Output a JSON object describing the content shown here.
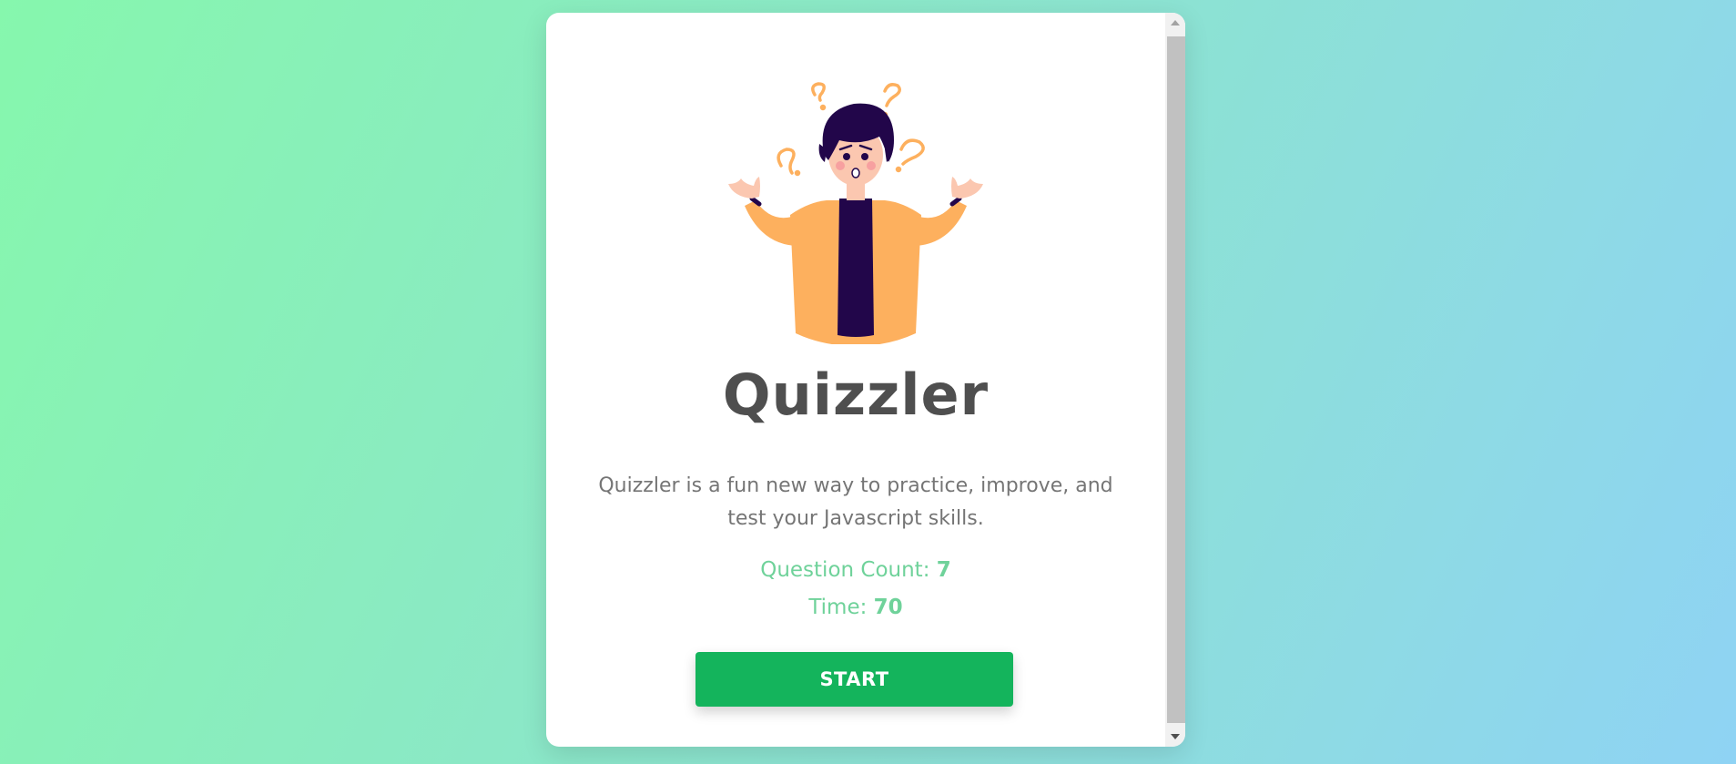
{
  "app": {
    "title": "Quizzler",
    "description": "Quizzler is a fun new way to practice, improve, and test your Javascript skills."
  },
  "stats": {
    "question_count_label": "Question Count: ",
    "question_count_value": "7",
    "time_label": "Time: ",
    "time_value": "70"
  },
  "actions": {
    "start_label": "START"
  },
  "illustration": {
    "icon": "confused-person-illustration"
  },
  "scrollbar": {
    "up_icon": "scroll-up-arrow-icon",
    "down_icon": "scroll-down-arrow-icon"
  },
  "colors": {
    "accent_green": "#14b45c",
    "stat_green": "#6fd29a",
    "title_gray": "#4f4f4f",
    "text_gray": "#757575",
    "jacket_orange": "#fdb05e",
    "shirt_purple": "#22064a"
  }
}
